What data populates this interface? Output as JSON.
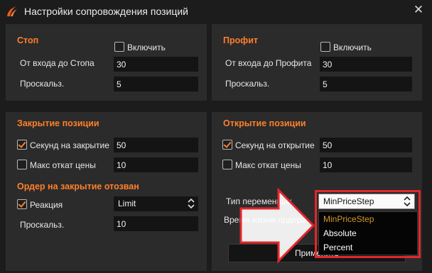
{
  "window": {
    "title": "Настройки сопровождения позиций",
    "close_glyph": "✕",
    "accent": "#ff7f2a",
    "annotation_color": "#e3272b"
  },
  "stop": {
    "title": "Стоп",
    "enable_label": "Включить",
    "enable_checked": false,
    "entry_label": "От входа до Стопа",
    "entry_value": "30",
    "slip_label": "Проскальз.",
    "slip_value": "5"
  },
  "profit": {
    "title": "Профит",
    "enable_label": "Включить",
    "enable_checked": false,
    "entry_label": "От входа до Профита",
    "entry_value": "30",
    "slip_label": "Проскальз.",
    "slip_value": "5"
  },
  "close_pos": {
    "title": "Закрытие позиции",
    "seconds_label": "Секунд на закрытие",
    "seconds_checked": true,
    "seconds_value": "50",
    "rollback_label": "Макс откат цены",
    "rollback_checked": false,
    "rollback_value": "10"
  },
  "order_cancelled": {
    "title": "Ордер на закрытие отозван",
    "reaction_label": "Реакция",
    "reaction_checked": true,
    "reaction_value": "Limit",
    "slip_label": "Проскальз.",
    "slip_value": "10"
  },
  "open_pos": {
    "title": "Открытие позиции",
    "seconds_label": "Секунд на открытие",
    "seconds_checked": true,
    "seconds_value": "50",
    "rollback_label": "Макс откат цены",
    "rollback_checked": false,
    "rollback_value": "10"
  },
  "variable": {
    "type_label": "Тип переменных",
    "lifetime_label": "Время жизни ордера",
    "selected": "MinPriceStep",
    "options": [
      "MinPriceStep",
      "Absolute",
      "Percent"
    ]
  },
  "apply_label": "Применить"
}
